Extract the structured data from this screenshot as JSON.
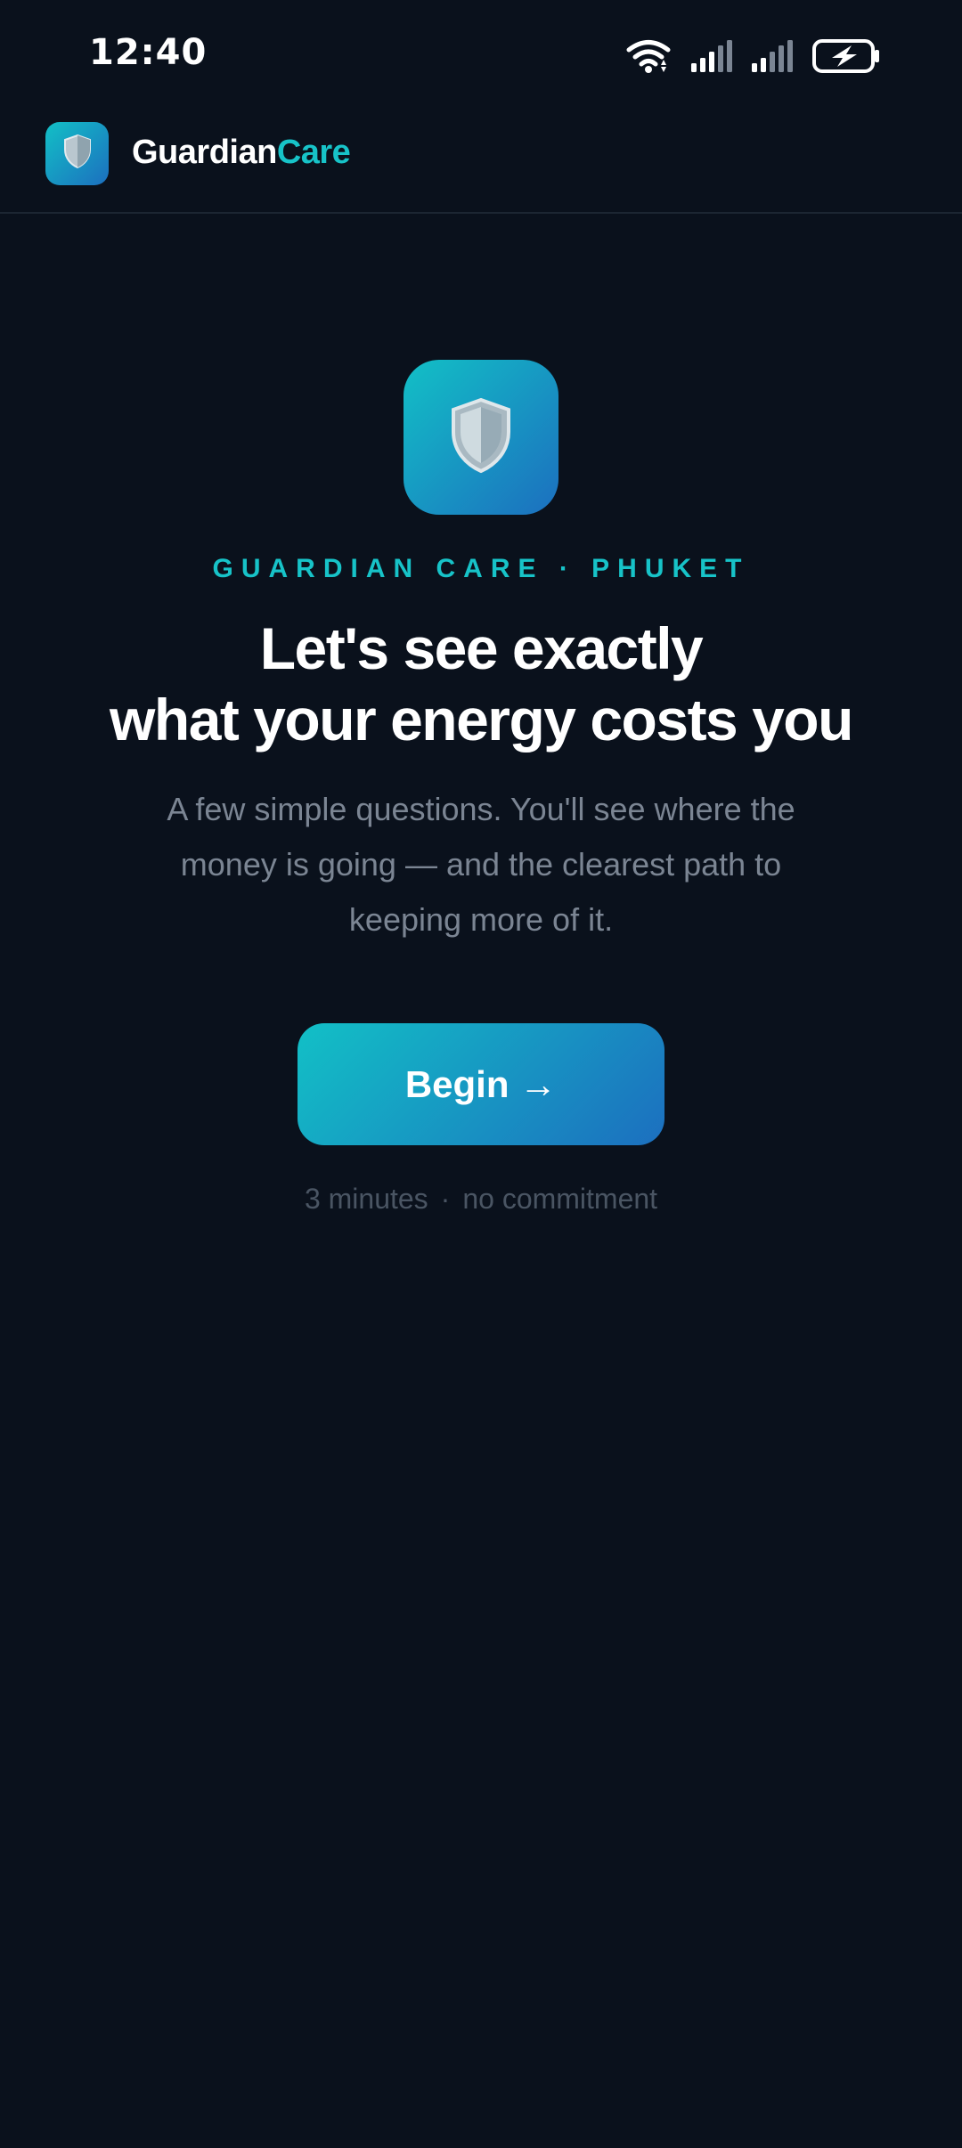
{
  "status_bar": {
    "time": "12:40",
    "icons": [
      "wifi-icon",
      "signal-icon",
      "signal-icon",
      "battery-charging-icon"
    ]
  },
  "header": {
    "logo_icon": "shield-icon",
    "title_part1": "Guardian",
    "title_part2": "Care"
  },
  "hero": {
    "icon": "shield-icon",
    "eyebrow": "GUARDIAN CARE · PHUKET",
    "headline_line1": "Let's see exactly",
    "headline_line2": "what your energy costs you",
    "subtext": "A few simple questions. You'll see where the money is going — and the clearest path to keeping more of it.",
    "button_label": "Begin →",
    "footnote_part1": "3 minutes",
    "footnote_separator": "·",
    "footnote_part2": "no commitment"
  },
  "colors": {
    "background": "#0a111c",
    "accent": "#17c3c8",
    "gradient_start": "#12c0c6",
    "gradient_end": "#1c6fbf",
    "muted_text": "#7b8593",
    "faint_text": "#4a5563"
  }
}
